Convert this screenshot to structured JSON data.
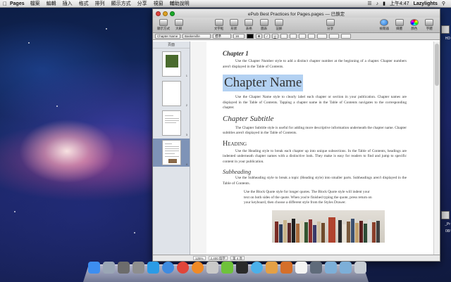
{
  "menubar": {
    "app": "Pages",
    "items": [
      "檔案",
      "編輯",
      "插入",
      "格式",
      "排列",
      "顯示方式",
      "分享",
      "視窗",
      "輔助說明"
    ],
    "time": "上午4:47",
    "user": "Lazylights"
  },
  "window": {
    "title": "ePub Best Practices for Pages.pages — 已鎖定",
    "toolbar": [
      "顯示方式",
      "大綱",
      "文字框",
      "形狀",
      "表格",
      "圖表",
      "註解",
      "分享",
      "檢閱器",
      "媒體",
      "顏色",
      "字體"
    ],
    "format": {
      "style": "Baskerville",
      "weight": "標準",
      "size": "16",
      "paragraph_style": "Chapter Name"
    },
    "thumb_header": "頁面",
    "pages": [
      {
        "num": "1",
        "selected": false
      },
      {
        "num": "2",
        "selected": false
      },
      {
        "num": "3",
        "selected": false
      },
      {
        "num": "4",
        "selected": true
      }
    ],
    "status": {
      "zoom": "125%",
      "words": "2,400 個字",
      "page": "第 4 頁"
    }
  },
  "document": {
    "chapter_label": "Chapter 1",
    "p1": "Use the Chapter Number style to add a distinct chapter number at the beginning of a chapter. Chapter numbers aren't displayed in the Table of Contents.",
    "chapter_name": "Chapter Name",
    "p2": "Use the Chapter Name style to clearly label each chapter or section in your publication. Chapter names are displayed in the Table of Contents. Tapping a chapter name in the Table of Contents navigates to the corresponding chapter.",
    "chapter_subtitle": "Chapter Subtitle",
    "p3": "The Chapter Subtitle style is useful for adding more descriptive information underneath the chapter name. Chapter subtitles aren't displayed in the Table of Contents.",
    "heading": "Heading",
    "p4": "Use the Heading style to break each chapter up into unique subsections. In the Table of Contents, headings are indented underneath chapter names with a distinctive look. They make is easy for readers to find and jump to specific content in your publication.",
    "subheading": "Subheading",
    "p5": "Use the Subheading style to break a topic (Heading style) into smaller parts. Subheadings aren't displayed in the Table of Contents.",
    "quote": "Use the Block Quote style for longer quotes. The Block Quote style will indent your text on both sides of the quote. When you're finished typing the quote, press return on your keyboard, then choose a different style from the Styles Drawer."
  },
  "desktop": {
    "side_labels": [
      "HD",
      "_Pr",
      "08/"
    ]
  },
  "dock": {
    "icons": [
      "finder-icon",
      "launchpad-icon",
      "mission-control-icon",
      "system-prefs-icon",
      "app-store-icon",
      "safari-icon",
      "chrome-icon",
      "firefox-icon",
      "photo-icon",
      "utorrent-icon",
      "terminal-icon",
      "itunes-icon",
      "preview-icon",
      "pages-icon",
      "calendar-icon",
      "screenshot-icon",
      "folder-icon",
      "downloads-icon",
      "trash-icon"
    ],
    "colors": [
      "#3d8ef0",
      "#9aa6b5",
      "#6c6c6c",
      "#8e8e8e",
      "#2b9be6",
      "#3f8be0",
      "#e0453a",
      "#f08a26",
      "#c9c9c9",
      "#6ec23b",
      "#2a2a2a",
      "#4bb0ea",
      "#e4a045",
      "#d56f2a",
      "#f4f4f4",
      "#5f6b7a",
      "#7dafd8",
      "#7dafd8",
      "#c7cdd4"
    ]
  }
}
